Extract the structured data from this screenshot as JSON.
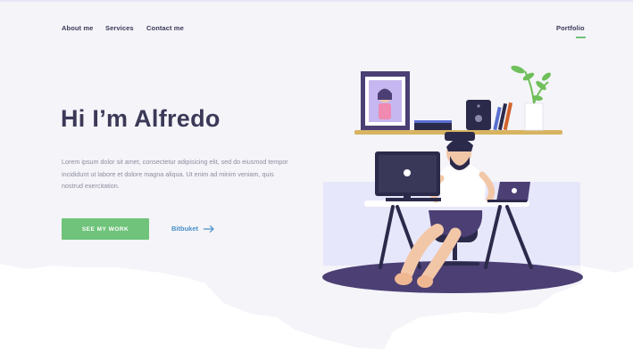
{
  "nav": {
    "about": "About me",
    "services": "Services",
    "contact": "Contact me",
    "portfolio": "Portfolio"
  },
  "hero": {
    "title": "Hi I’m Alfredo",
    "body": "Lorem ipsum dolor sit amet, consectetur adipisicing elit, sed do eiusmod tempor incididunt ut labore et dolore magna aliqua. Ut enim ad minim veniam, quis nostrud exercitation.",
    "cta_label": "SEE MY WORK",
    "secondary_label": "Bitbuket"
  },
  "colors": {
    "accent_green": "#6fc37a",
    "link_blue": "#4a90c8",
    "heading": "#3b3957",
    "body_text": "#8d8ca0",
    "floor": "#4b3f74"
  },
  "icons": {
    "secondary_arrow": "arrow-right-icon"
  }
}
